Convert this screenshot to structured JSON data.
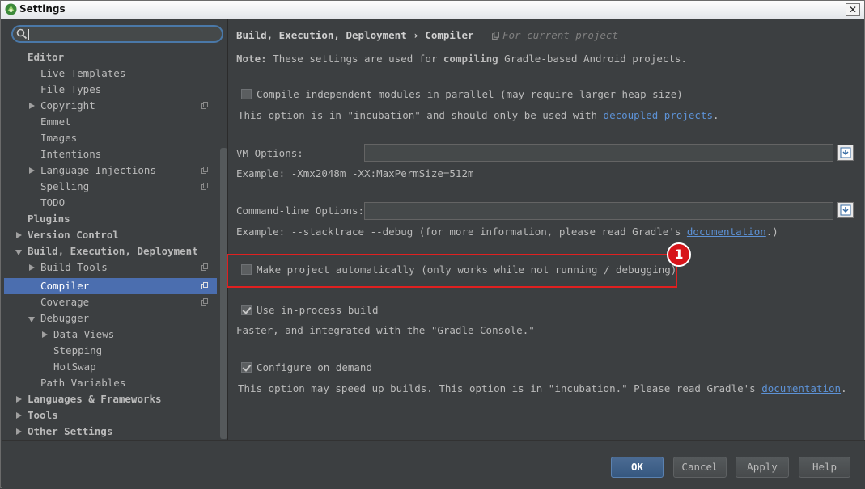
{
  "window": {
    "title": "Settings",
    "close_glyph": "✕"
  },
  "search": {
    "value": ""
  },
  "tree": [
    {
      "label": "Editor",
      "bold": true
    },
    {
      "label": "Live Templates"
    },
    {
      "label": "File Types"
    },
    {
      "label": "Copyright"
    },
    {
      "label": "Emmet"
    },
    {
      "label": "Images"
    },
    {
      "label": "Intentions"
    },
    {
      "label": "Language Injections"
    },
    {
      "label": "Spelling"
    },
    {
      "label": "TODO"
    },
    {
      "label": "Plugins",
      "bold": true
    },
    {
      "label": "Version Control",
      "bold": true
    },
    {
      "label": "Build, Execution, Deployment",
      "bold": true
    },
    {
      "label": "Build Tools"
    },
    {
      "label": "Compiler",
      "selected": true
    },
    {
      "label": "Coverage"
    },
    {
      "label": "Debugger"
    },
    {
      "label": "Data Views"
    },
    {
      "label": "Stepping"
    },
    {
      "label": "HotSwap"
    },
    {
      "label": "Path Variables"
    },
    {
      "label": "Languages & Frameworks",
      "bold": true
    },
    {
      "label": "Tools",
      "bold": true
    },
    {
      "label": "Other Settings",
      "bold": true
    }
  ],
  "breadcrumb": {
    "parent": "Build, Execution, Deployment",
    "separator": "›",
    "current": "Compiler",
    "scope": "For current project"
  },
  "note": {
    "prefix": "Note:",
    "text1": "These settings are used for",
    "keyword": "compiling",
    "text2": "Gradle-based Android projects."
  },
  "options": {
    "parallel": {
      "label": "Compile independent modules in parallel (may require larger heap size)",
      "checked": false
    },
    "parallel_desc": {
      "text": "This option is in \"incubation\" and should only be used with",
      "link": "decoupled projects",
      "suffix": "."
    },
    "vm": {
      "label": "VM Options:",
      "value": "",
      "example": "Example: -Xmx2048m -XX:MaxPermSize=512m"
    },
    "cmd": {
      "label": "Command-line Options:",
      "value": "",
      "example": "Example: --stacktrace --debug (for more information, please read Gradle's",
      "link": "documentation",
      "suffix": ".)"
    },
    "make_auto": {
      "label": "Make project automatically (only works while not running / debugging)",
      "checked": false,
      "badge": "1"
    },
    "in_process": {
      "label": "Use in-process build",
      "checked": true,
      "desc": "Faster, and integrated with the \"Gradle Console.\""
    },
    "on_demand": {
      "label": "Configure on demand",
      "checked": true,
      "desc": "This option may speed up builds. This option is in \"incubation.\" Please read Gradle's",
      "link": "documentation",
      "suffix": "."
    }
  },
  "buttons": {
    "ok": "OK",
    "cancel": "Cancel",
    "apply": "Apply",
    "help": "Help"
  }
}
